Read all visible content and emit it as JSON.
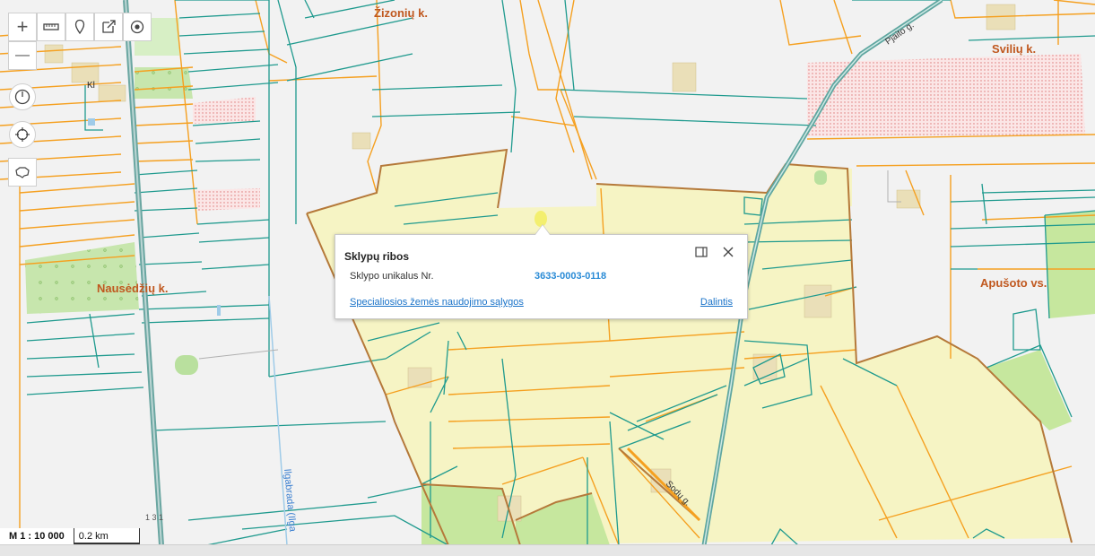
{
  "map": {
    "labels": {
      "place_1": "Žizonių k.",
      "place_2": "Svilių k.",
      "place_3": "Nausėdžių k.",
      "place_4": "Apušoto vs.",
      "place_5": "Kl",
      "road_1": "Pjaito g.",
      "road_2": "Sodų g.",
      "river": "Ilgabrada (Ilga",
      "road_num": "1 3 1"
    }
  },
  "toolbar": {
    "zoom_in": "+",
    "zoom_out": "—"
  },
  "popup": {
    "title": "Sklypų ribos",
    "field_label": "Sklypo unikalus Nr.",
    "field_value": "3633-0003-0118",
    "link": "Specialiosios žemės naudojimo sąlygos",
    "share": "Dalintis"
  },
  "scale": {
    "ratio": "M 1 : 10 000",
    "distance": "0.2 km"
  },
  "colors": {
    "parcel_line_teal": "#1f9a8e",
    "parcel_line_orange": "#f5a020",
    "parcel_fill": "#f5f3c2",
    "boundary_brown": "#b5793a",
    "green_area": "#c8e6a6",
    "link_blue": "#1a73c9"
  }
}
